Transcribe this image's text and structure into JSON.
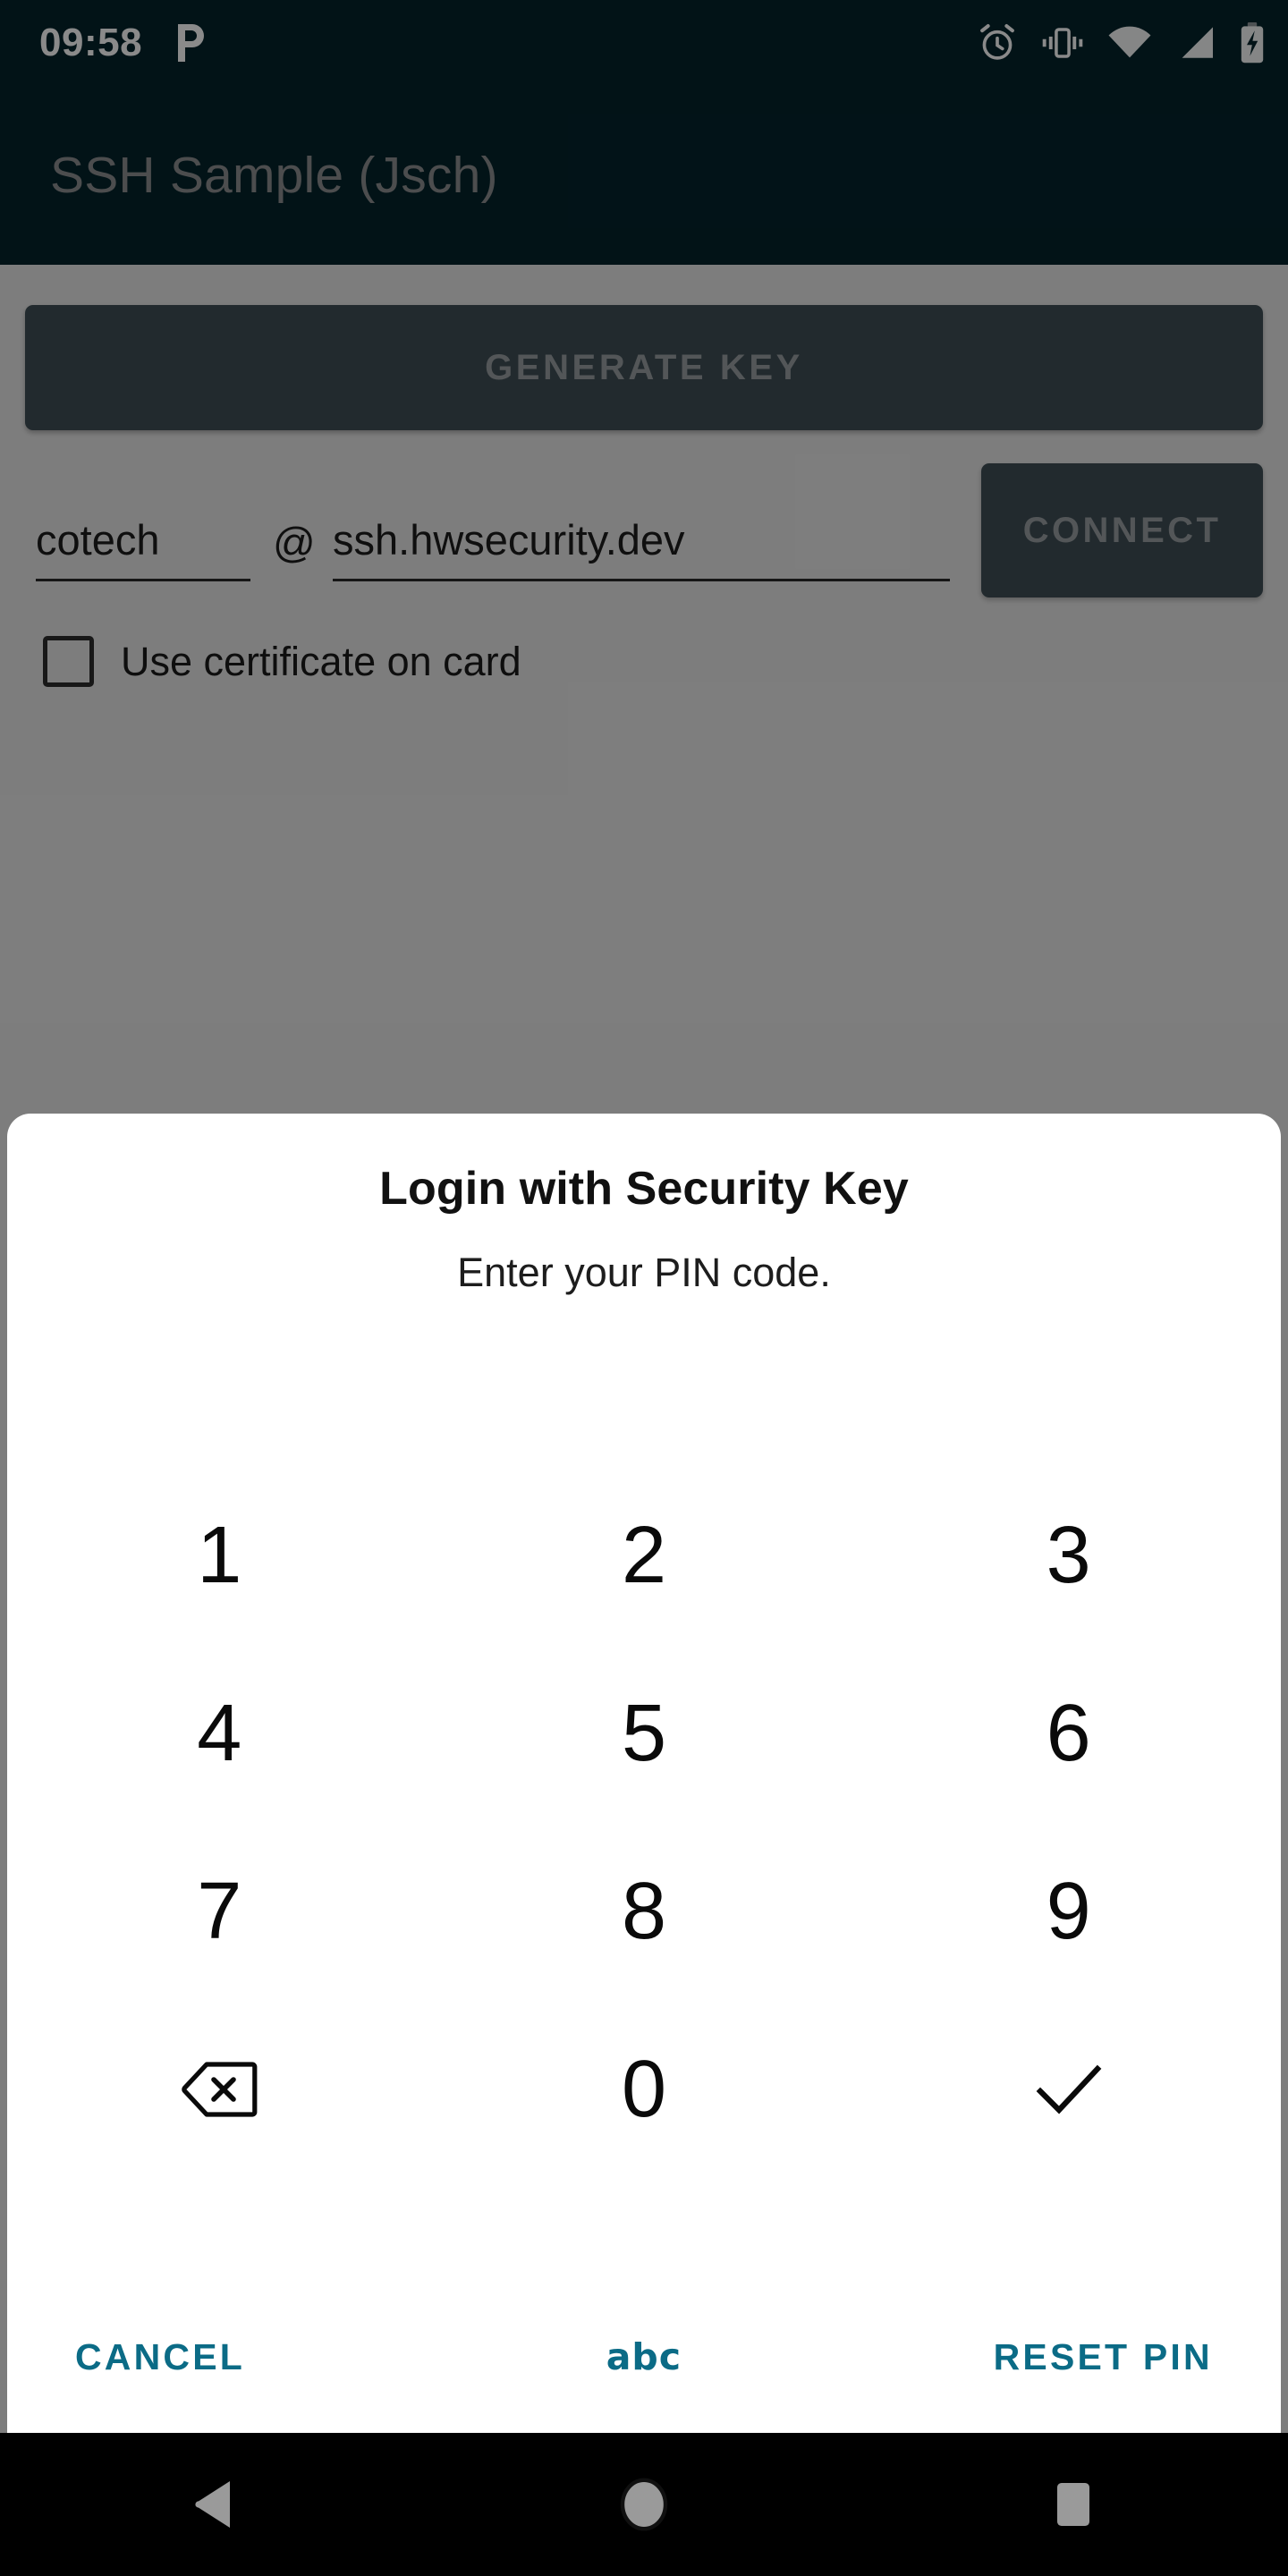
{
  "statusbar": {
    "clock": "09:58",
    "notification_icon": "pin-p-icon",
    "icons": [
      "alarm-icon",
      "vibrate-icon",
      "wifi-icon",
      "cellular-signal-icon",
      "battery-charging-icon"
    ],
    "background_color": "#04242c",
    "foreground_color": "#ffffff"
  },
  "appbar": {
    "title": "SSH Sample (Jsch)",
    "background_color": "#04242c",
    "title_color": "#8d8f90"
  },
  "app": {
    "generate_key_label": "GENERATE KEY",
    "username_value": "cotech",
    "at_separator": "@",
    "host_value": "ssh.hwsecurity.dev",
    "connect_label": "CONNECT",
    "certificate_checkbox_label": "Use certificate on card",
    "certificate_checked": false,
    "button_color": "#3f4e56"
  },
  "dialog": {
    "title": "Login with Security Key",
    "subtitle": "Enter your PIN code.",
    "background_color": "#ffffff",
    "accent_color": "#0b6b86",
    "keypad": [
      {
        "label": "1",
        "type": "digit"
      },
      {
        "label": "2",
        "type": "digit"
      },
      {
        "label": "3",
        "type": "digit"
      },
      {
        "label": "4",
        "type": "digit"
      },
      {
        "label": "5",
        "type": "digit"
      },
      {
        "label": "6",
        "type": "digit"
      },
      {
        "label": "7",
        "type": "digit"
      },
      {
        "label": "8",
        "type": "digit"
      },
      {
        "label": "9",
        "type": "digit"
      },
      {
        "label": "",
        "type": "backspace"
      },
      {
        "label": "0",
        "type": "digit"
      },
      {
        "label": "",
        "type": "confirm"
      }
    ],
    "actions": {
      "cancel_label": "CANCEL",
      "keyboard_toggle_label": "abc",
      "reset_pin_label": "RESET PIN"
    }
  },
  "navbar": {
    "back_icon": "back-triangle-icon",
    "home_icon": "home-circle-icon",
    "recents_icon": "recents-square-icon",
    "background_color": "#000000"
  }
}
